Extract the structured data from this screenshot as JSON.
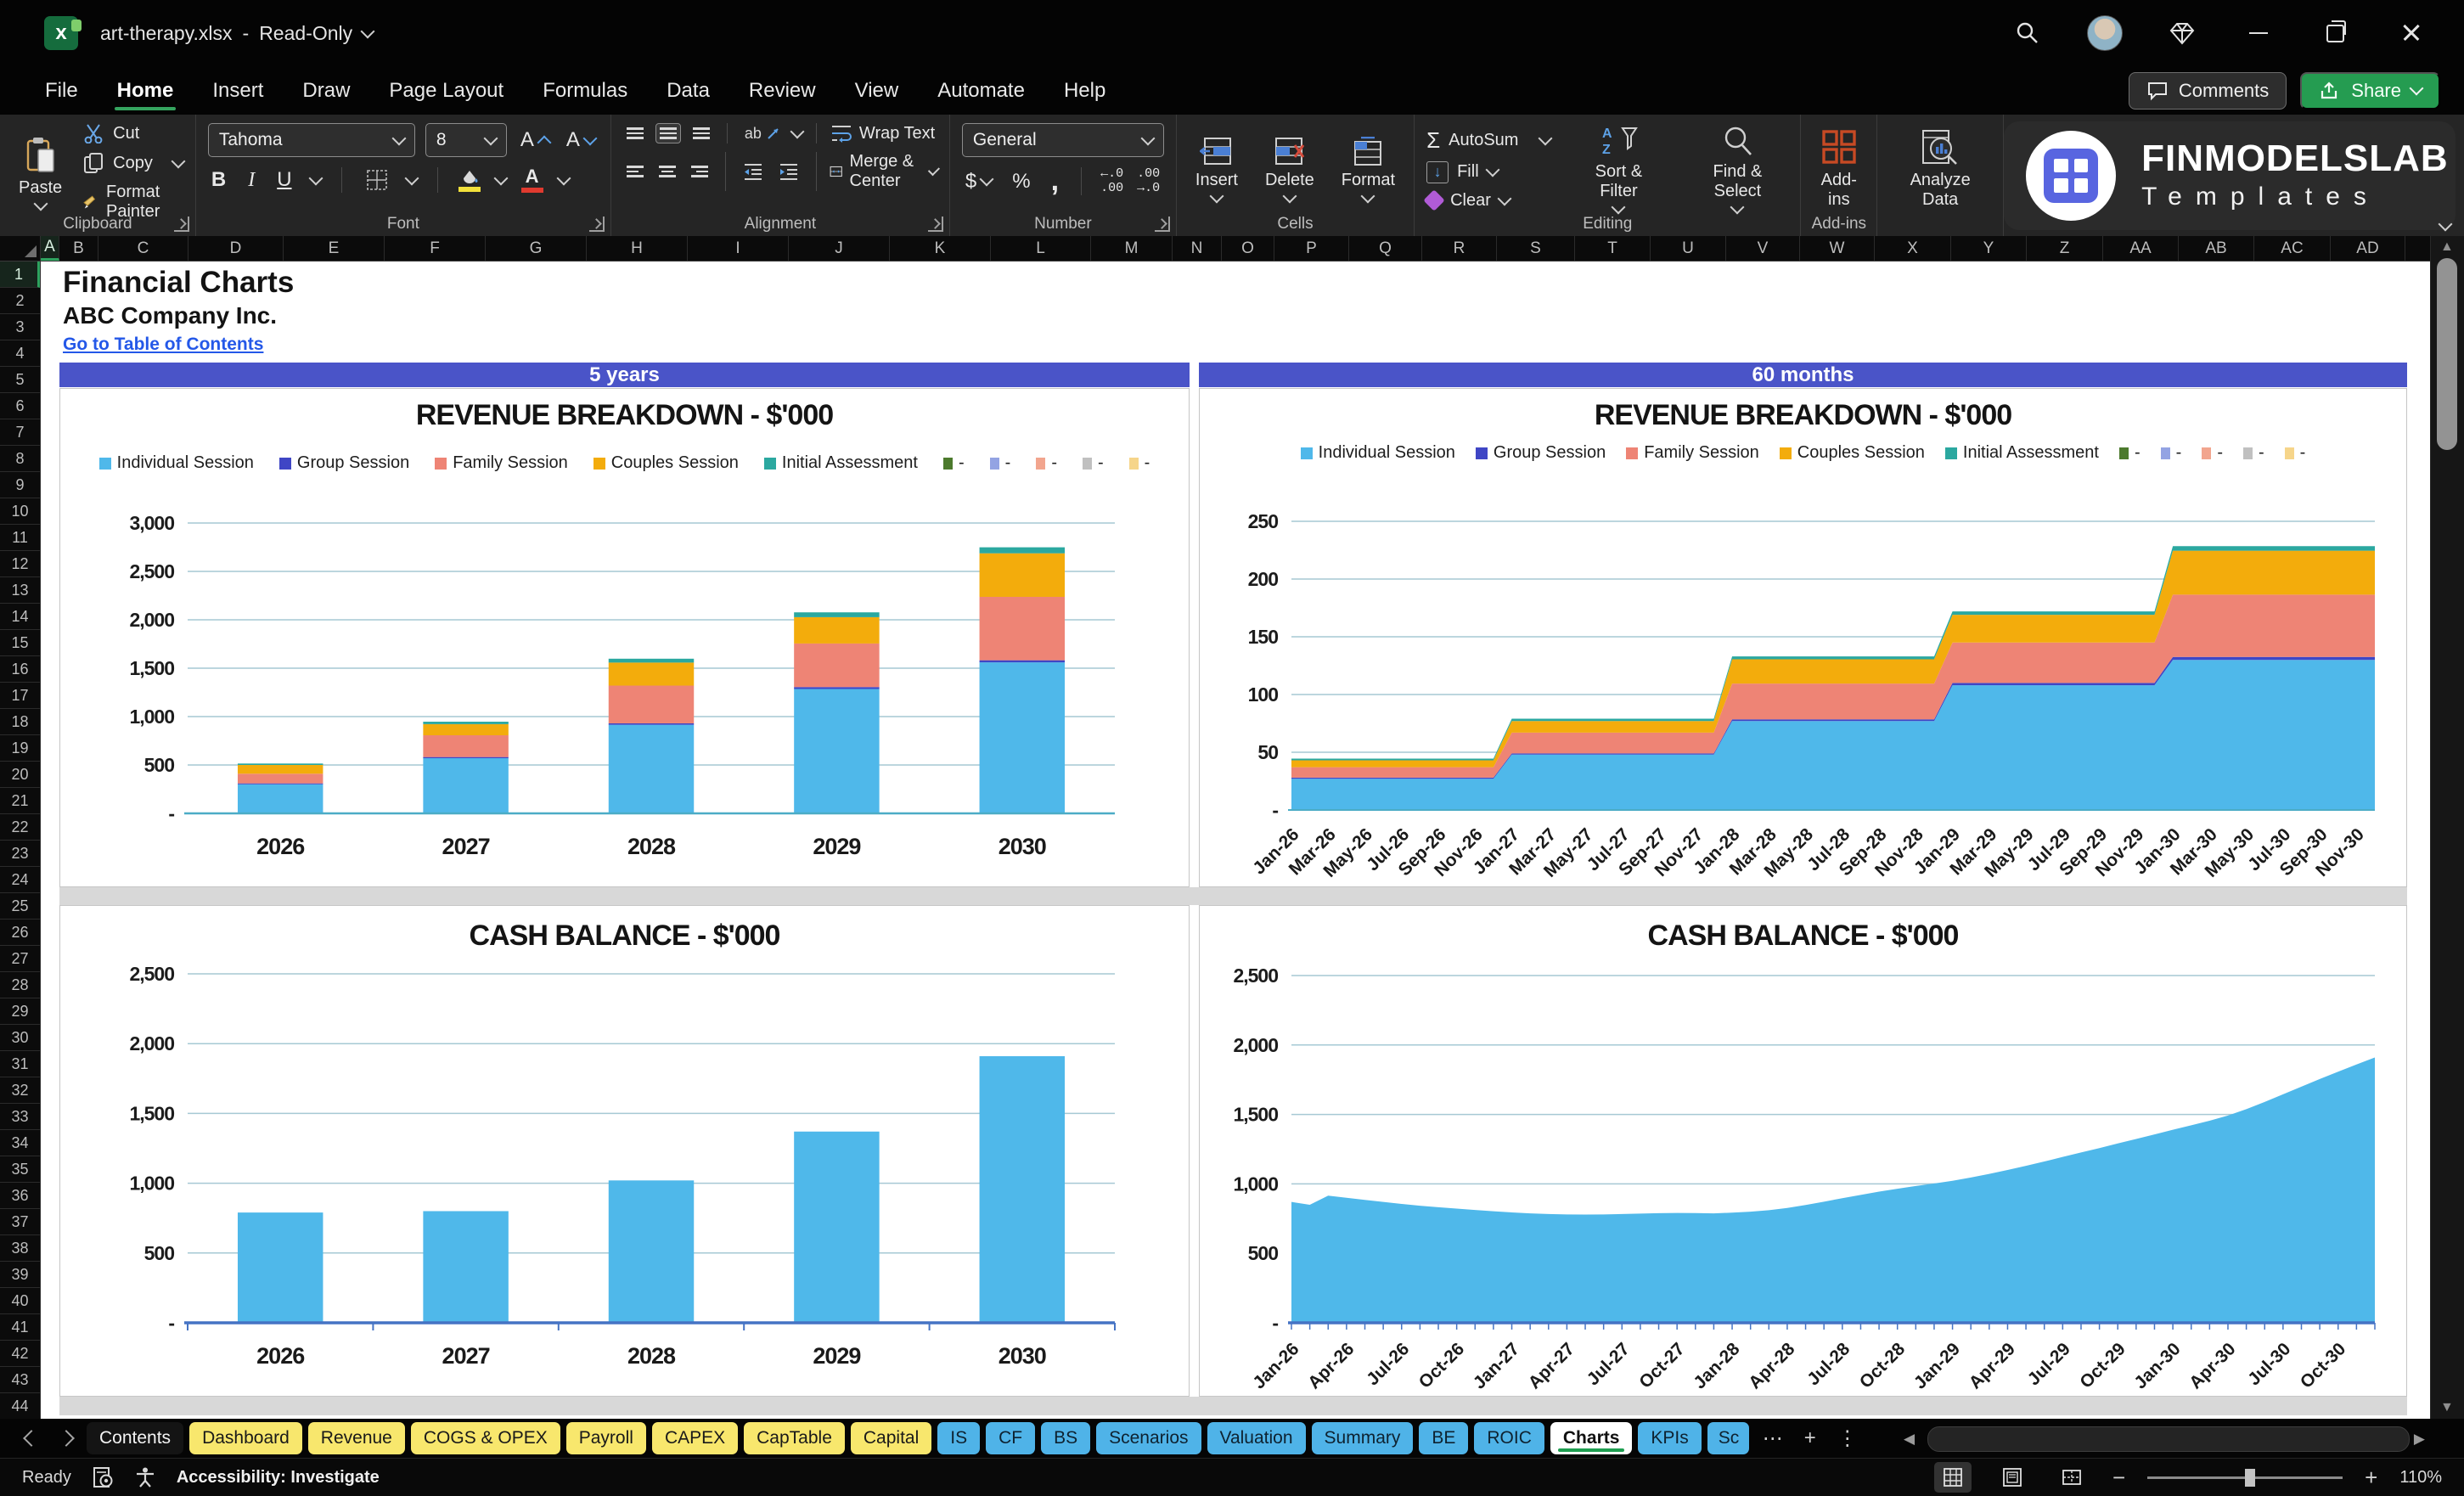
{
  "titlebar": {
    "filename": "art-therapy.xlsx",
    "separator": "-",
    "mode": "Read-Only"
  },
  "menubar": {
    "tabs": [
      "File",
      "Home",
      "Insert",
      "Draw",
      "Page Layout",
      "Formulas",
      "Data",
      "Review",
      "View",
      "Automate",
      "Help"
    ],
    "active_tab": "Home",
    "comments_label": "Comments",
    "share_label": "Share"
  },
  "ribbon": {
    "clipboard": {
      "group": "Clipboard",
      "paste": "Paste",
      "cut": "Cut",
      "copy": "Copy",
      "format_painter": "Format Painter"
    },
    "font": {
      "group": "Font",
      "family": "Tahoma",
      "size": "8",
      "bold": "B",
      "italic": "I",
      "underline": "U"
    },
    "alignment": {
      "group": "Alignment",
      "wrap_text": "Wrap Text",
      "merge_center": "Merge & Center",
      "orient": "ab"
    },
    "number": {
      "group": "Number",
      "format": "General",
      "currency": "$",
      "percent": "%",
      "comma": ",",
      "inc_decimal": "←.0\n.00",
      "dec_decimal": ".00\n→.0"
    },
    "cells": {
      "group": "Cells",
      "insert": "Insert",
      "delete": "Delete",
      "format": "Format"
    },
    "editing": {
      "group": "Editing",
      "autosum": "AutoSum",
      "fill": "Fill",
      "clear": "Clear",
      "sort_filter": "Sort & Filter",
      "find_select": "Find & Select"
    },
    "addins": {
      "group": "Add-ins",
      "addins": "Add-ins",
      "analyze_data": "Analyze Data"
    },
    "logo": {
      "title": "FINMODELSLAB",
      "subtitle": "Templates"
    }
  },
  "sheet": {
    "columns": [
      "A",
      "B",
      "C",
      "D",
      "E",
      "F",
      "G",
      "H",
      "I",
      "J",
      "K",
      "L",
      "M",
      "N",
      "O",
      "P",
      "Q",
      "R",
      "S",
      "T",
      "U",
      "V",
      "W",
      "X",
      "Y",
      "Z",
      "AA",
      "AB",
      "AC",
      "AD"
    ],
    "rows_visible": 44,
    "page_title": "Financial Charts",
    "company": "ABC Company Inc.",
    "toc_link": "Go to Table of Contents",
    "banner_left": "5 years",
    "banner_right": "60 months"
  },
  "legend": {
    "named": [
      {
        "label": "Individual Session",
        "color": "#4FB8EA"
      },
      {
        "label": "Group Session",
        "color": "#3F46C5"
      },
      {
        "label": "Family Session",
        "color": "#EE8475"
      },
      {
        "label": "Couples Session",
        "color": "#F3AC0C"
      },
      {
        "label": "Initial Assessment",
        "color": "#2BA8A0"
      }
    ],
    "extras": [
      {
        "label": "-",
        "color": "#4C7A2D"
      },
      {
        "label": "-",
        "color": "#93A3E3"
      },
      {
        "label": "-",
        "color": "#F2A58E"
      },
      {
        "label": "-",
        "color": "#C0C0C0"
      },
      {
        "label": "-",
        "color": "#F6D58A"
      }
    ]
  },
  "chart_data": [
    {
      "id": "revenue_5y",
      "type": "bar",
      "stacked": true,
      "title": "REVENUE BREAKDOWN - $'000",
      "categories": [
        "2026",
        "2027",
        "2028",
        "2029",
        "2030"
      ],
      "series": [
        {
          "name": "Individual Session",
          "color": "#4FB8EA",
          "values": [
            300,
            570,
            915,
            1285,
            1560
          ]
        },
        {
          "name": "Group Session",
          "color": "#3F46C5",
          "values": [
            10,
            12,
            15,
            20,
            22
          ]
        },
        {
          "name": "Family Session",
          "color": "#EE8475",
          "values": [
            100,
            225,
            390,
            450,
            655
          ]
        },
        {
          "name": "Couples Session",
          "color": "#F3AC0C",
          "values": [
            90,
            115,
            238,
            272,
            450
          ]
        },
        {
          "name": "Initial Assessment",
          "color": "#2BA8A0",
          "values": [
            15,
            25,
            40,
            50,
            62
          ]
        }
      ],
      "ylim": [
        0,
        3000
      ],
      "ystep": 500,
      "ytick_labels": [
        "-",
        "500",
        "1,000",
        "1,500",
        "2,000",
        "2,500",
        "3,000"
      ],
      "grid": true,
      "legend_position": "top"
    },
    {
      "id": "revenue_60m",
      "type": "area",
      "stacked": true,
      "step_months": 12,
      "months": 60,
      "title": "REVENUE BREAKDOWN - $'000",
      "x_tick_labels": [
        "Jan-26",
        "Mar-26",
        "May-26",
        "Jul-26",
        "Sep-26",
        "Nov-26",
        "Jan-27",
        "Mar-27",
        "May-27",
        "Jul-27",
        "Sep-27",
        "Nov-27",
        "Jan-28",
        "Mar-28",
        "May-28",
        "Jul-28",
        "Sep-28",
        "Nov-28",
        "Jan-29",
        "Mar-29",
        "May-29",
        "Jul-29",
        "Sep-29",
        "Nov-29",
        "Jan-30",
        "Mar-30",
        "May-30",
        "Jul-30",
        "Sep-30",
        "Nov-30"
      ],
      "series": [
        {
          "name": "Individual Session",
          "color": "#4FB8EA",
          "yearly_levels": [
            27,
            48,
            77,
            108,
            130
          ]
        },
        {
          "name": "Group Session",
          "color": "#3F46C5",
          "yearly_levels": [
            1,
            1,
            1.5,
            2,
            2.5
          ]
        },
        {
          "name": "Family Session",
          "color": "#EE8475",
          "yearly_levels": [
            9,
            18,
            31,
            35,
            54
          ]
        },
        {
          "name": "Couples Session",
          "color": "#F3AC0C",
          "yearly_levels": [
            6,
            10,
            21,
            24,
            38
          ]
        },
        {
          "name": "Initial Assessment",
          "color": "#2BA8A0",
          "yearly_levels": [
            1.5,
            2,
            2.5,
            3,
            4
          ]
        }
      ],
      "ylim": [
        0,
        250
      ],
      "ystep": 50,
      "ytick_labels": [
        "-",
        "50",
        "100",
        "150",
        "200",
        "250"
      ],
      "grid": true,
      "legend_position": "top"
    },
    {
      "id": "cash_5y",
      "type": "bar",
      "stacked": false,
      "title": "CASH BALANCE - $'000",
      "categories": [
        "2026",
        "2027",
        "2028",
        "2029",
        "2030"
      ],
      "series": [
        {
          "name": "Cash balance",
          "color": "#4FB8EA",
          "values": [
            790,
            800,
            1020,
            1370,
            1910
          ]
        }
      ],
      "ylim": [
        0,
        2500
      ],
      "ystep": 500,
      "ytick_labels": [
        "-",
        "500",
        "1,000",
        "1,500",
        "2,000",
        "2,500"
      ],
      "grid": true,
      "axis_color": "#4573C4"
    },
    {
      "id": "cash_60m",
      "type": "area",
      "stacked": false,
      "months": 60,
      "title": "CASH BALANCE - $'000",
      "x_tick_labels": [
        "Jan-26",
        "Apr-26",
        "Jul-26",
        "Oct-26",
        "Jan-27",
        "Apr-27",
        "Jul-27",
        "Oct-27",
        "Jan-28",
        "Apr-28",
        "Jul-28",
        "Oct-28",
        "Jan-29",
        "Apr-29",
        "Jul-29",
        "Oct-29",
        "Jan-30",
        "Apr-30",
        "Jul-30",
        "Oct-30"
      ],
      "series": [
        {
          "name": "Cash balance",
          "color": "#4FB8EA",
          "monthly_values": [
            870,
            850,
            915,
            900,
            885,
            870,
            856,
            843,
            832,
            822,
            812,
            803,
            795,
            788,
            783,
            780,
            779,
            780,
            783,
            786,
            789,
            791,
            790,
            788,
            793,
            800,
            811,
            827,
            848,
            872,
            897,
            921,
            944,
            965,
            985,
            1003,
            1022,
            1046,
            1072,
            1100,
            1130,
            1161,
            1194,
            1226,
            1258,
            1291,
            1323,
            1356,
            1390,
            1422,
            1455,
            1492,
            1538,
            1590,
            1645,
            1700,
            1755,
            1808,
            1860,
            1910
          ]
        }
      ],
      "ylim": [
        0,
        2500
      ],
      "ystep": 500,
      "ytick_labels": [
        "-",
        "500",
        "1,000",
        "1,500",
        "2,000",
        "2,500"
      ],
      "grid": true,
      "axis_color": "#4573C4"
    }
  ],
  "tabbar": {
    "sheets": [
      {
        "name": "Contents",
        "style": "dark"
      },
      {
        "name": "Dashboard",
        "style": "yellow"
      },
      {
        "name": "Revenue",
        "style": "yellow"
      },
      {
        "name": "COGS & OPEX",
        "style": "yellow"
      },
      {
        "name": "Payroll",
        "style": "yellow"
      },
      {
        "name": "CAPEX",
        "style": "yellow"
      },
      {
        "name": "CapTable",
        "style": "yellow"
      },
      {
        "name": "Capital",
        "style": "yellow"
      },
      {
        "name": "IS",
        "style": "blue"
      },
      {
        "name": "CF",
        "style": "blue"
      },
      {
        "name": "BS",
        "style": "blue"
      },
      {
        "name": "Scenarios",
        "style": "blue"
      },
      {
        "name": "Valuation",
        "style": "blue"
      },
      {
        "name": "Summary",
        "style": "blue"
      },
      {
        "name": "BE",
        "style": "blue"
      },
      {
        "name": "ROIC",
        "style": "blue"
      },
      {
        "name": "Charts",
        "style": "active"
      },
      {
        "name": "KPIs",
        "style": "blue"
      },
      {
        "name": "Sc",
        "style": "blue",
        "clipped": true
      }
    ]
  },
  "statusbar": {
    "ready": "Ready",
    "accessibility": "Accessibility: Investigate",
    "zoom_level": "110%"
  }
}
